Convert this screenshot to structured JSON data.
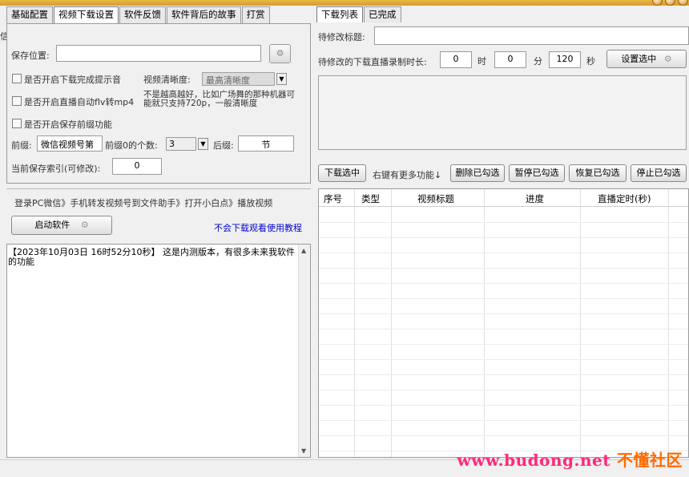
{
  "colors": {
    "link": "#0000cc",
    "watermark_a": "#ff2a7a",
    "watermark_b": "#ff6a00"
  },
  "left_tabs": [
    "基础配置",
    "视频下载设置",
    "软件反馈",
    "软件背后的故事",
    "打赏"
  ],
  "settings": {
    "save_location_label": "保存位置:",
    "save_location_value": "",
    "download_done_sound": "是否开启下载完成提示音",
    "quality_label": "视频清晰度:",
    "quality_value": "最高清晰度",
    "auto_convert": "是否开启直播自动flv转mp4",
    "quality_note": "不是越高越好，比如广场舞的那种机器可能就只支持720p，一般清晰度",
    "prefix_toggle": "是否开启保存前缀功能",
    "prefix_label": "前缀:",
    "prefix_value": "微信视频号第",
    "prefix_zero_label": "前缀0的个数:",
    "prefix_zero_value": "3",
    "suffix_label": "后缀:",
    "suffix_value": "节",
    "index_label": "当前保存索引(可修改):",
    "index_value": "0"
  },
  "guide_text": "登录PC微信》手机转发视频号到文件助手》打开小白点》播放视频",
  "start_button": "启动软件",
  "tutorial_link": "不会下载观看使用教程",
  "log_text": "【2023年10月03日 16时52分10秒】 这是内测版本，有很多未来我软件的功能",
  "right_tabs": [
    "下载列表",
    "已完成"
  ],
  "edit": {
    "title_label": "待修改标题:",
    "title_value": "",
    "duration_label": "待修改的下载直播录制时长:",
    "hours_value": "0",
    "hours_unit": "时",
    "minutes_value": "0",
    "minutes_unit": "分",
    "seconds_value": "120",
    "seconds_unit": "秒",
    "apply_button": "设置选中"
  },
  "actions": {
    "download_selected": "下载选中",
    "more_hint": "右键有更多功能↓",
    "delete_checked": "删除已勾选",
    "pause_checked": "暂停已勾选",
    "resume_checked": "恢复已勾选",
    "stop_checked": "停止已勾选"
  },
  "table_headers": [
    "序号",
    "类型",
    "视频标题",
    "进度",
    "直播定时(秒)"
  ],
  "watermark": {
    "a": "www.budong.net",
    "b": "不懂社区"
  }
}
